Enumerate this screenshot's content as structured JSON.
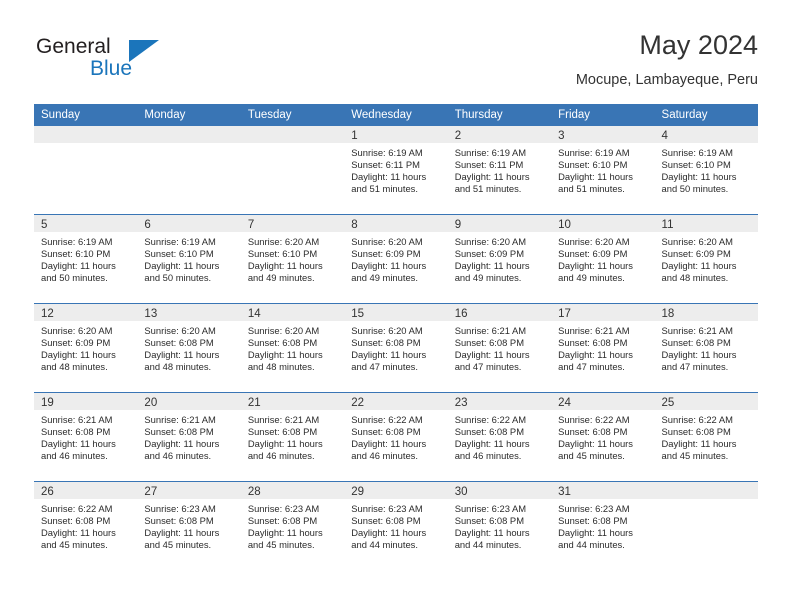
{
  "brand": {
    "name_part1": "General",
    "name_part2": "Blue",
    "accent_color": "#1b75bb"
  },
  "header": {
    "title": "May 2024",
    "location": "Mocupe, Lambayeque, Peru"
  },
  "theme": {
    "header_row_bg": "#3975b5",
    "daynum_band_bg": "#ededed",
    "row_divider": "#3975b5",
    "text": "#333333"
  },
  "calendar": {
    "weekday_headers": [
      "Sunday",
      "Monday",
      "Tuesday",
      "Wednesday",
      "Thursday",
      "Friday",
      "Saturday"
    ],
    "weeks": [
      [
        {
          "day": "",
          "empty": true
        },
        {
          "day": "",
          "empty": true
        },
        {
          "day": "",
          "empty": true
        },
        {
          "day": "1",
          "sunrise": "Sunrise: 6:19 AM",
          "sunset": "Sunset: 6:11 PM",
          "daylight1": "Daylight: 11 hours",
          "daylight2": "and 51 minutes."
        },
        {
          "day": "2",
          "sunrise": "Sunrise: 6:19 AM",
          "sunset": "Sunset: 6:11 PM",
          "daylight1": "Daylight: 11 hours",
          "daylight2": "and 51 minutes."
        },
        {
          "day": "3",
          "sunrise": "Sunrise: 6:19 AM",
          "sunset": "Sunset: 6:10 PM",
          "daylight1": "Daylight: 11 hours",
          "daylight2": "and 51 minutes."
        },
        {
          "day": "4",
          "sunrise": "Sunrise: 6:19 AM",
          "sunset": "Sunset: 6:10 PM",
          "daylight1": "Daylight: 11 hours",
          "daylight2": "and 50 minutes."
        }
      ],
      [
        {
          "day": "5",
          "sunrise": "Sunrise: 6:19 AM",
          "sunset": "Sunset: 6:10 PM",
          "daylight1": "Daylight: 11 hours",
          "daylight2": "and 50 minutes."
        },
        {
          "day": "6",
          "sunrise": "Sunrise: 6:19 AM",
          "sunset": "Sunset: 6:10 PM",
          "daylight1": "Daylight: 11 hours",
          "daylight2": "and 50 minutes."
        },
        {
          "day": "7",
          "sunrise": "Sunrise: 6:20 AM",
          "sunset": "Sunset: 6:10 PM",
          "daylight1": "Daylight: 11 hours",
          "daylight2": "and 49 minutes."
        },
        {
          "day": "8",
          "sunrise": "Sunrise: 6:20 AM",
          "sunset": "Sunset: 6:09 PM",
          "daylight1": "Daylight: 11 hours",
          "daylight2": "and 49 minutes."
        },
        {
          "day": "9",
          "sunrise": "Sunrise: 6:20 AM",
          "sunset": "Sunset: 6:09 PM",
          "daylight1": "Daylight: 11 hours",
          "daylight2": "and 49 minutes."
        },
        {
          "day": "10",
          "sunrise": "Sunrise: 6:20 AM",
          "sunset": "Sunset: 6:09 PM",
          "daylight1": "Daylight: 11 hours",
          "daylight2": "and 49 minutes."
        },
        {
          "day": "11",
          "sunrise": "Sunrise: 6:20 AM",
          "sunset": "Sunset: 6:09 PM",
          "daylight1": "Daylight: 11 hours",
          "daylight2": "and 48 minutes."
        }
      ],
      [
        {
          "day": "12",
          "sunrise": "Sunrise: 6:20 AM",
          "sunset": "Sunset: 6:09 PM",
          "daylight1": "Daylight: 11 hours",
          "daylight2": "and 48 minutes."
        },
        {
          "day": "13",
          "sunrise": "Sunrise: 6:20 AM",
          "sunset": "Sunset: 6:08 PM",
          "daylight1": "Daylight: 11 hours",
          "daylight2": "and 48 minutes."
        },
        {
          "day": "14",
          "sunrise": "Sunrise: 6:20 AM",
          "sunset": "Sunset: 6:08 PM",
          "daylight1": "Daylight: 11 hours",
          "daylight2": "and 48 minutes."
        },
        {
          "day": "15",
          "sunrise": "Sunrise: 6:20 AM",
          "sunset": "Sunset: 6:08 PM",
          "daylight1": "Daylight: 11 hours",
          "daylight2": "and 47 minutes."
        },
        {
          "day": "16",
          "sunrise": "Sunrise: 6:21 AM",
          "sunset": "Sunset: 6:08 PM",
          "daylight1": "Daylight: 11 hours",
          "daylight2": "and 47 minutes."
        },
        {
          "day": "17",
          "sunrise": "Sunrise: 6:21 AM",
          "sunset": "Sunset: 6:08 PM",
          "daylight1": "Daylight: 11 hours",
          "daylight2": "and 47 minutes."
        },
        {
          "day": "18",
          "sunrise": "Sunrise: 6:21 AM",
          "sunset": "Sunset: 6:08 PM",
          "daylight1": "Daylight: 11 hours",
          "daylight2": "and 47 minutes."
        }
      ],
      [
        {
          "day": "19",
          "sunrise": "Sunrise: 6:21 AM",
          "sunset": "Sunset: 6:08 PM",
          "daylight1": "Daylight: 11 hours",
          "daylight2": "and 46 minutes."
        },
        {
          "day": "20",
          "sunrise": "Sunrise: 6:21 AM",
          "sunset": "Sunset: 6:08 PM",
          "daylight1": "Daylight: 11 hours",
          "daylight2": "and 46 minutes."
        },
        {
          "day": "21",
          "sunrise": "Sunrise: 6:21 AM",
          "sunset": "Sunset: 6:08 PM",
          "daylight1": "Daylight: 11 hours",
          "daylight2": "and 46 minutes."
        },
        {
          "day": "22",
          "sunrise": "Sunrise: 6:22 AM",
          "sunset": "Sunset: 6:08 PM",
          "daylight1": "Daylight: 11 hours",
          "daylight2": "and 46 minutes."
        },
        {
          "day": "23",
          "sunrise": "Sunrise: 6:22 AM",
          "sunset": "Sunset: 6:08 PM",
          "daylight1": "Daylight: 11 hours",
          "daylight2": "and 46 minutes."
        },
        {
          "day": "24",
          "sunrise": "Sunrise: 6:22 AM",
          "sunset": "Sunset: 6:08 PM",
          "daylight1": "Daylight: 11 hours",
          "daylight2": "and 45 minutes."
        },
        {
          "day": "25",
          "sunrise": "Sunrise: 6:22 AM",
          "sunset": "Sunset: 6:08 PM",
          "daylight1": "Daylight: 11 hours",
          "daylight2": "and 45 minutes."
        }
      ],
      [
        {
          "day": "26",
          "sunrise": "Sunrise: 6:22 AM",
          "sunset": "Sunset: 6:08 PM",
          "daylight1": "Daylight: 11 hours",
          "daylight2": "and 45 minutes."
        },
        {
          "day": "27",
          "sunrise": "Sunrise: 6:23 AM",
          "sunset": "Sunset: 6:08 PM",
          "daylight1": "Daylight: 11 hours",
          "daylight2": "and 45 minutes."
        },
        {
          "day": "28",
          "sunrise": "Sunrise: 6:23 AM",
          "sunset": "Sunset: 6:08 PM",
          "daylight1": "Daylight: 11 hours",
          "daylight2": "and 45 minutes."
        },
        {
          "day": "29",
          "sunrise": "Sunrise: 6:23 AM",
          "sunset": "Sunset: 6:08 PM",
          "daylight1": "Daylight: 11 hours",
          "daylight2": "and 44 minutes."
        },
        {
          "day": "30",
          "sunrise": "Sunrise: 6:23 AM",
          "sunset": "Sunset: 6:08 PM",
          "daylight1": "Daylight: 11 hours",
          "daylight2": "and 44 minutes."
        },
        {
          "day": "31",
          "sunrise": "Sunrise: 6:23 AM",
          "sunset": "Sunset: 6:08 PM",
          "daylight1": "Daylight: 11 hours",
          "daylight2": "and 44 minutes."
        },
        {
          "day": "",
          "empty": true
        }
      ]
    ]
  }
}
